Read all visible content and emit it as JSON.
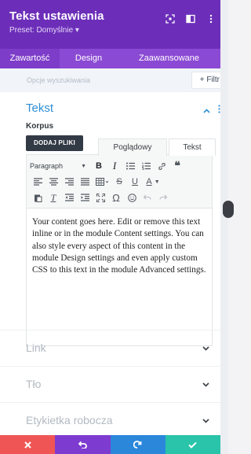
{
  "header": {
    "title": "Tekst ustawienia",
    "preset": "Preset: Domyślnie ▾",
    "icons": [
      "expand-icon",
      "sidebar-toggle-icon",
      "more-vertical-icon"
    ]
  },
  "tabs": [
    {
      "label": "Zawartość",
      "active": true
    },
    {
      "label": "Design",
      "active": false
    },
    {
      "label": "Zaawansowane",
      "active": false
    }
  ],
  "search": {
    "placeholder": "Opcje wyszukiwania",
    "filter_label": "+ Filtr"
  },
  "section_text": {
    "title": "Tekst",
    "field_label": "Korpus",
    "add_media_label": "DODAJ PLIKI",
    "mode_visual": "Poglądowy",
    "mode_text": "Tekst",
    "format_select": "Paragraph",
    "content": "Your content goes here. Edit or remove this text inline or in the module Content settings. You can also style every aspect of this content in the module Design settings and even apply custom CSS to this text in the module Advanced settings."
  },
  "collapsed_sections": [
    {
      "label": "Link"
    },
    {
      "label": "Tło"
    },
    {
      "label": "Etykietka robocza"
    }
  ],
  "footer": {
    "icons": [
      "close-icon",
      "undo-icon",
      "redo-icon",
      "check-icon"
    ],
    "colors": [
      "#ef5555",
      "#7e3bd0",
      "#2b87da",
      "#29c4a9"
    ]
  },
  "colors": {
    "header_bg": "#6c2eb9",
    "tabs_bg": "#8b4ad4",
    "accent_blue": "#2f8fd4"
  }
}
